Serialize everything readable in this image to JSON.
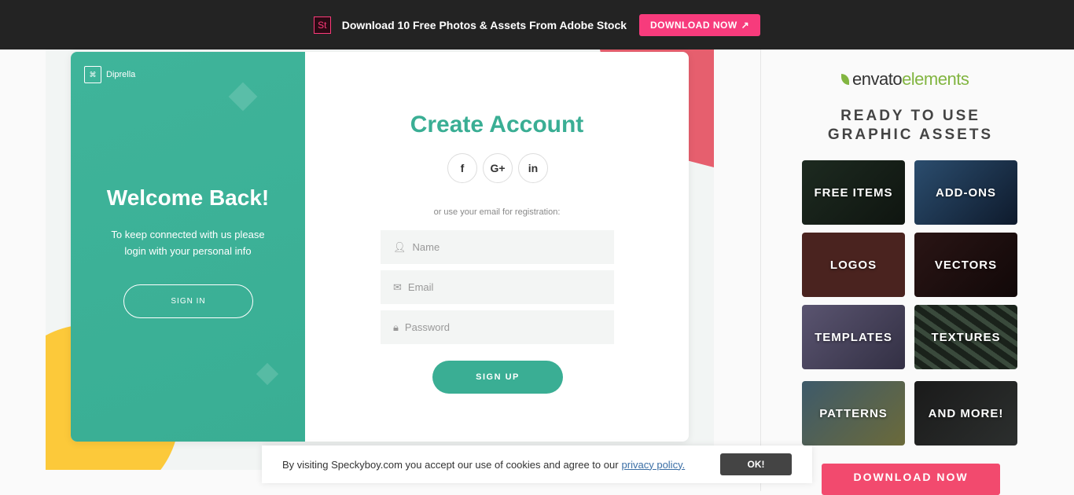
{
  "topbar": {
    "badge": "St",
    "message": "Download 10 Free Photos & Assets From Adobe Stock",
    "button": "DOWNLOAD NOW",
    "button_icon": "external-link-icon"
  },
  "card": {
    "brand": "Diprella",
    "welcome_title": "Welcome Back!",
    "welcome_text": "To keep connected with us please login with your personal info",
    "sign_in": "SIGN IN",
    "title": "Create Account",
    "socials": [
      "f",
      "G+",
      "in"
    ],
    "or_text": "or use your email for registration:",
    "fields": [
      {
        "placeholder": "Name",
        "icon": "user-icon"
      },
      {
        "placeholder": "Email",
        "icon": "mail-icon"
      },
      {
        "placeholder": "Password",
        "icon": "lock-icon"
      }
    ],
    "sign_up": "SIGN UP"
  },
  "sidebar": {
    "logo_a": "envato",
    "logo_b": "elements",
    "headline_1": "READY TO USE",
    "headline_2": "GRAPHIC ASSETS",
    "tiles": [
      "FREE ITEMS",
      "ADD-ONS",
      "LOGOS",
      "VECTORS",
      "TEMPLATES",
      "TEXTURES",
      "PATTERNS",
      "AND MORE!"
    ],
    "download": "DOWNLOAD NOW"
  },
  "cookie": {
    "text": "By visiting Speckyboy.com you accept our use of cookies and agree to our",
    "link": "privacy policy.",
    "ok": "OK!"
  },
  "colors": {
    "accent": "#3aae94",
    "pink": "#f73b7c",
    "envato_green": "#82b541"
  }
}
